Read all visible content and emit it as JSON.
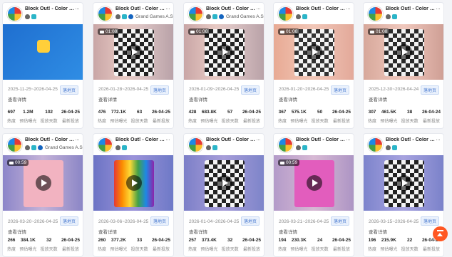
{
  "cards": [
    {
      "title": "Block Out! - Color Sort ...",
      "publisher": "",
      "duration": "",
      "media": "blue",
      "date": "2025-11-25~2026-04-25",
      "link": "查看详情",
      "tag": "落地页",
      "stats": [
        "697",
        "1.2M",
        "102",
        "26-04-25"
      ]
    },
    {
      "title": "Block Out! - Color Sort ...",
      "publisher": "Grand Games A.S.",
      "duration": "01:00",
      "media": "pink",
      "date": "2026-01-28~2026-04-25",
      "link": "查看详情",
      "tag": "落地页",
      "stats": [
        "476",
        "772.1K",
        "63",
        "26-04-25"
      ]
    },
    {
      "title": "Block Out! - Color Sort ...",
      "publisher": "Grand Games A.S.",
      "duration": "01:00",
      "media": "pink",
      "date": "2026-01-09~2026-04-25",
      "link": "查看详情",
      "tag": "落地页",
      "stats": [
        "428",
        "683.8K",
        "57",
        "26-04-25"
      ]
    },
    {
      "title": "Block Out! - Color Sort ...",
      "publisher": "",
      "duration": "01:00",
      "media": "salmon",
      "date": "2026-01-20~2026-04-25",
      "link": "查看详情",
      "tag": "落地页",
      "stats": [
        "367",
        "575.1K",
        "50",
        "26-04-25"
      ]
    },
    {
      "title": "Block Out! - Color Sort ...",
      "publisher": "",
      "duration": "01:00",
      "media": "peach",
      "date": "2025-12-30~2026-04-24",
      "link": "查看详情",
      "tag": "落地页",
      "stats": [
        "307",
        "461.5K",
        "38",
        "26-04-24"
      ]
    },
    {
      "title": "Block Out! - Color Sort ...",
      "publisher": "Grand Games A.S.",
      "duration": "00:59",
      "media": "lilac",
      "date": "2026-03-20~2026-04-25",
      "link": "查看详情",
      "tag": "落地页",
      "stats": [
        "266",
        "384.1K",
        "32",
        "26-04-25"
      ]
    },
    {
      "title": "Block Out! - Color Sort ...",
      "publisher": "",
      "duration": "",
      "media": "purple",
      "date": "2026-03-06~2026-04-25",
      "link": "查看详情",
      "tag": "落地页",
      "stats": [
        "260",
        "377.2K",
        "33",
        "26-04-25"
      ]
    },
    {
      "title": "Block Out! - Color Sort ...",
      "publisher": "",
      "duration": "",
      "media": "purple2",
      "date": "2026-01-04~2026-04-25",
      "link": "查看详情",
      "tag": "落地页",
      "stats": [
        "257",
        "373.4K",
        "32",
        "26-04-25"
      ]
    },
    {
      "title": "Block Out! - Color Sort ...",
      "publisher": "",
      "duration": "00:59",
      "media": "lilac2",
      "date": "2026-03-21~2026-04-25",
      "link": "查看详情",
      "tag": "落地页",
      "stats": [
        "194",
        "230.3K",
        "24",
        "26-04-25"
      ]
    },
    {
      "title": "Block Out! - Color Sort ...",
      "publisher": "",
      "duration": "",
      "media": "purple3",
      "date": "2026-03-15~2026-04-25",
      "link": "查看详情",
      "tag": "落地页",
      "stats": [
        "196",
        "215.9K",
        "22",
        "26-04-25"
      ]
    }
  ],
  "stat_labels": [
    "热度",
    "预估曝光",
    "投放天数",
    "最新投放"
  ],
  "icons": {
    "more": "more-icon",
    "apple": "apple-icon",
    "google_play": "google-play-icon",
    "publisher": "publisher-icon",
    "camera": "video-camera-icon",
    "play": "play-icon",
    "scroll_top": "scroll-to-top-icon"
  },
  "colors": {
    "accent": "#4a7bd0",
    "fab": "#ff5722"
  }
}
